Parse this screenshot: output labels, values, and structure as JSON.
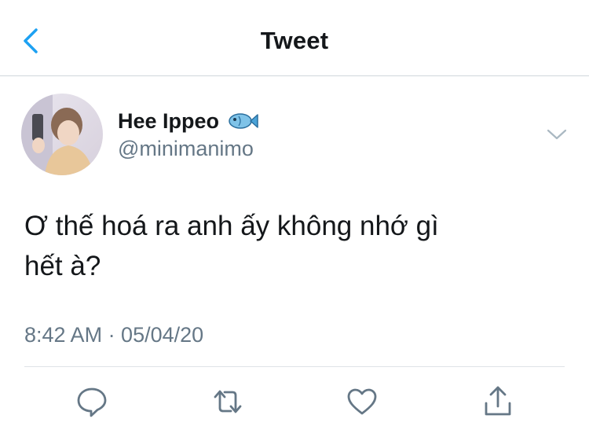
{
  "header": {
    "title": "Tweet",
    "back_icon": "chevron-left-icon",
    "accent_color": "#1da1f2"
  },
  "tweet": {
    "display_name": "Hee Ippeo",
    "name_emoji": "fish-icon",
    "handle": "@minimanimo",
    "text_line1": "Ơ thế hoá ra anh ấy không nhớ gì",
    "text_line2": "hết à?",
    "timestamp": "8:42 AM · 05/04/20"
  },
  "actions": [
    {
      "name": "reply",
      "icon": "comment-icon"
    },
    {
      "name": "retweet",
      "icon": "retweet-icon"
    },
    {
      "name": "like",
      "icon": "heart-icon"
    },
    {
      "name": "share",
      "icon": "share-icon"
    }
  ],
  "colors": {
    "text": "#14171a",
    "secondary": "#657786",
    "icon": "#657786",
    "divider": "#dfe3e7"
  }
}
